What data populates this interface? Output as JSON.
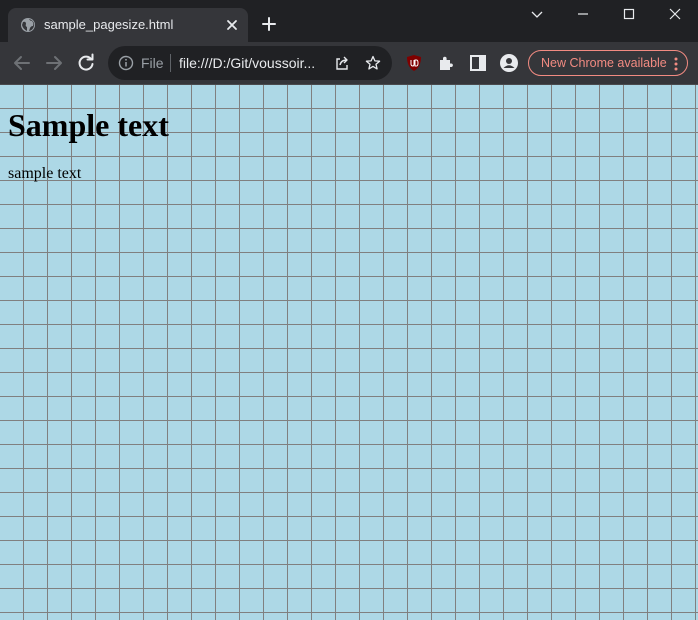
{
  "tab": {
    "title": "sample_pagesize.html"
  },
  "omnibox": {
    "scheme_chip": "File",
    "url": "file:///D:/Git/voussoir..."
  },
  "toolbar": {
    "update_label": "New Chrome available"
  },
  "page": {
    "heading": "Sample text",
    "paragraph": "sample text"
  },
  "colors": {
    "frame": "#202124",
    "toolbar": "#35363a",
    "page_background": "#add8e6",
    "grid_lines": "#808080",
    "update_accent": "#f28b82"
  },
  "icons": [
    "globe-icon",
    "close-icon",
    "plus-icon",
    "chevron-down-icon",
    "minimize-icon",
    "maximize-icon",
    "window-close-icon",
    "back-arrow-icon",
    "forward-arrow-icon",
    "reload-icon",
    "info-icon",
    "share-icon",
    "star-icon",
    "ublock-icon",
    "extensions-icon",
    "side-panel-icon",
    "profile-icon",
    "more-vert-icon"
  ]
}
